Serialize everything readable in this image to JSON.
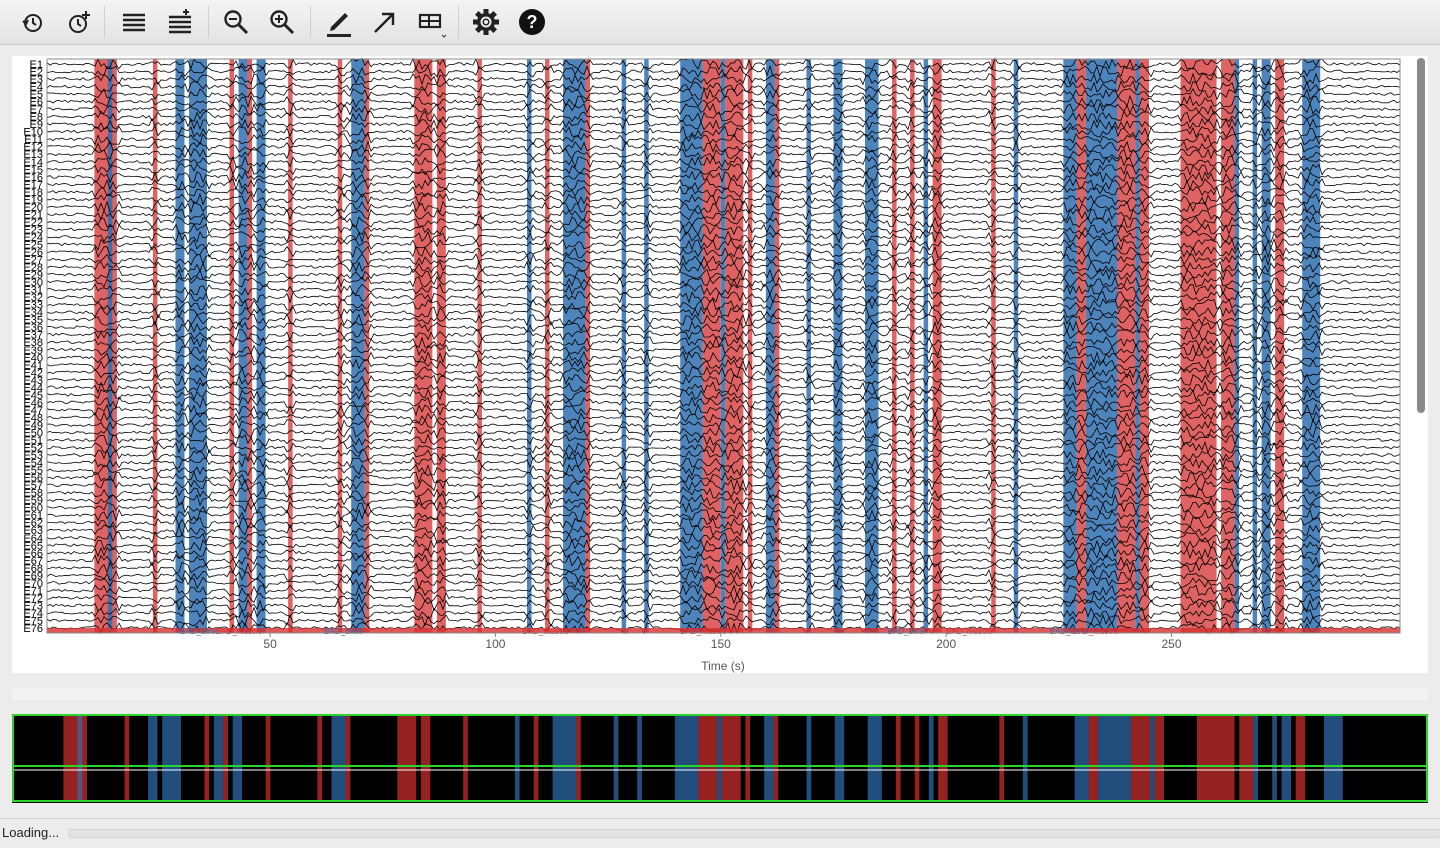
{
  "toolbar": {
    "buttons": [
      {
        "name": "history-back-button",
        "icon": "clock-back-icon",
        "tooltip": ""
      },
      {
        "name": "history-forward-button",
        "icon": "clock-plus-icon",
        "tooltip": ""
      },
      {
        "name": "fewer-channels-button",
        "icon": "lines-icon",
        "tooltip": ""
      },
      {
        "name": "more-channels-button",
        "icon": "lines-plus-icon",
        "tooltip": ""
      },
      {
        "name": "zoom-out-button",
        "icon": "zoom-out-icon",
        "tooltip": ""
      },
      {
        "name": "zoom-in-button",
        "icon": "zoom-in-icon",
        "tooltip": ""
      },
      {
        "name": "annotate-button",
        "icon": "pencil-icon",
        "tooltip": ""
      },
      {
        "name": "arrow-button",
        "icon": "arrow-icon",
        "tooltip": ""
      },
      {
        "name": "projector-button",
        "icon": "projector-icon",
        "tooltip": ""
      },
      {
        "name": "settings-button",
        "icon": "gear-icon",
        "tooltip": ""
      },
      {
        "name": "help-button",
        "icon": "help-icon",
        "tooltip": ""
      }
    ]
  },
  "plot": {
    "xlabel": "Time (s)",
    "x_ticks": [
      "50",
      "100",
      "150",
      "200",
      "250"
    ],
    "channels": [
      "E1",
      "E2",
      "E3",
      "E4",
      "E5",
      "E6",
      "E7",
      "E8",
      "E9",
      "E10",
      "E11",
      "E12",
      "E13",
      "E14",
      "E15",
      "E16",
      "E17",
      "E18",
      "E19",
      "E20",
      "E21",
      "E22",
      "E23",
      "E24",
      "E25",
      "E26",
      "E27",
      "E28",
      "E29",
      "E30",
      "E31",
      "E32",
      "E33",
      "E34",
      "E35",
      "E36",
      "E37",
      "E38",
      "E39",
      "E40",
      "E41",
      "E42",
      "E43",
      "E44",
      "E45",
      "E46",
      "E47",
      "E48",
      "E49",
      "E50",
      "E51",
      "E52",
      "E53",
      "E54",
      "E55",
      "E56",
      "E57",
      "E58",
      "E59",
      "E60",
      "E61",
      "E62",
      "E63",
      "E64",
      "E65",
      "E66",
      "E67",
      "E68",
      "E69",
      "E70",
      "E71",
      "E72",
      "E73",
      "E74",
      "E75",
      "E76"
    ],
    "annotation_labels": [
      "BAD_blink",
      "BAD_muscle",
      "BAD_blink",
      "BAD_muscle",
      "BAD_muscle",
      "BAD_blink",
      "BAD_muscle",
      "BAD_blink",
      "BAD_muscle"
    ],
    "colors": {
      "blink": "#2f6fb0",
      "muscle": "#d62f2f",
      "trace": "#000000",
      "background": "#ffffff"
    },
    "annotations": [
      {
        "type": "muscle",
        "start": 11,
        "end": 16
      },
      {
        "type": "blink",
        "start": 14,
        "end": 15
      },
      {
        "type": "muscle",
        "start": 24,
        "end": 25
      },
      {
        "type": "blink",
        "start": 29,
        "end": 31
      },
      {
        "type": "blink",
        "start": 32,
        "end": 36
      },
      {
        "type": "muscle",
        "start": 41,
        "end": 42
      },
      {
        "type": "blink",
        "start": 43,
        "end": 45
      },
      {
        "type": "muscle",
        "start": 45,
        "end": 46
      },
      {
        "type": "blink",
        "start": 47,
        "end": 49
      },
      {
        "type": "muscle",
        "start": 54,
        "end": 55
      },
      {
        "type": "muscle",
        "start": 65,
        "end": 66
      },
      {
        "type": "blink",
        "start": 68,
        "end": 71
      },
      {
        "type": "muscle",
        "start": 71,
        "end": 72
      },
      {
        "type": "muscle",
        "start": 82,
        "end": 86
      },
      {
        "type": "muscle",
        "start": 87,
        "end": 89
      },
      {
        "type": "muscle",
        "start": 96,
        "end": 97
      },
      {
        "type": "blink",
        "start": 107,
        "end": 108
      },
      {
        "type": "muscle",
        "start": 111,
        "end": 112
      },
      {
        "type": "blink",
        "start": 115,
        "end": 120
      },
      {
        "type": "muscle",
        "start": 120,
        "end": 121
      },
      {
        "type": "blink",
        "start": 128,
        "end": 129
      },
      {
        "type": "blink",
        "start": 133,
        "end": 134
      },
      {
        "type": "blink",
        "start": 141,
        "end": 146
      },
      {
        "type": "muscle",
        "start": 146,
        "end": 150
      },
      {
        "type": "blink",
        "start": 150,
        "end": 151
      },
      {
        "type": "muscle",
        "start": 151,
        "end": 155
      },
      {
        "type": "muscle",
        "start": 156,
        "end": 157
      },
      {
        "type": "blink",
        "start": 160,
        "end": 162
      },
      {
        "type": "muscle",
        "start": 162,
        "end": 163
      },
      {
        "type": "blink",
        "start": 169,
        "end": 170
      },
      {
        "type": "blink",
        "start": 175,
        "end": 177
      },
      {
        "type": "blink",
        "start": 182,
        "end": 185
      },
      {
        "type": "muscle",
        "start": 188,
        "end": 189
      },
      {
        "type": "muscle",
        "start": 192,
        "end": 193
      },
      {
        "type": "blink",
        "start": 195,
        "end": 196
      },
      {
        "type": "muscle",
        "start": 197,
        "end": 199
      },
      {
        "type": "muscle",
        "start": 210,
        "end": 211
      },
      {
        "type": "blink",
        "start": 215,
        "end": 216
      },
      {
        "type": "blink",
        "start": 226,
        "end": 229
      },
      {
        "type": "muscle",
        "start": 229,
        "end": 231
      },
      {
        "type": "blink",
        "start": 231,
        "end": 238
      },
      {
        "type": "muscle",
        "start": 238,
        "end": 242
      },
      {
        "type": "blink",
        "start": 242,
        "end": 243
      },
      {
        "type": "muscle",
        "start": 243,
        "end": 245
      },
      {
        "type": "muscle",
        "start": 252,
        "end": 260
      },
      {
        "type": "muscle",
        "start": 261,
        "end": 264
      },
      {
        "type": "blink",
        "start": 264,
        "end": 265
      },
      {
        "type": "blink",
        "start": 268,
        "end": 269
      },
      {
        "type": "blink",
        "start": 270,
        "end": 272
      },
      {
        "type": "muscle",
        "start": 273,
        "end": 275
      },
      {
        "type": "blink",
        "start": 279,
        "end": 283
      }
    ]
  },
  "status": {
    "text": "Loading..."
  }
}
